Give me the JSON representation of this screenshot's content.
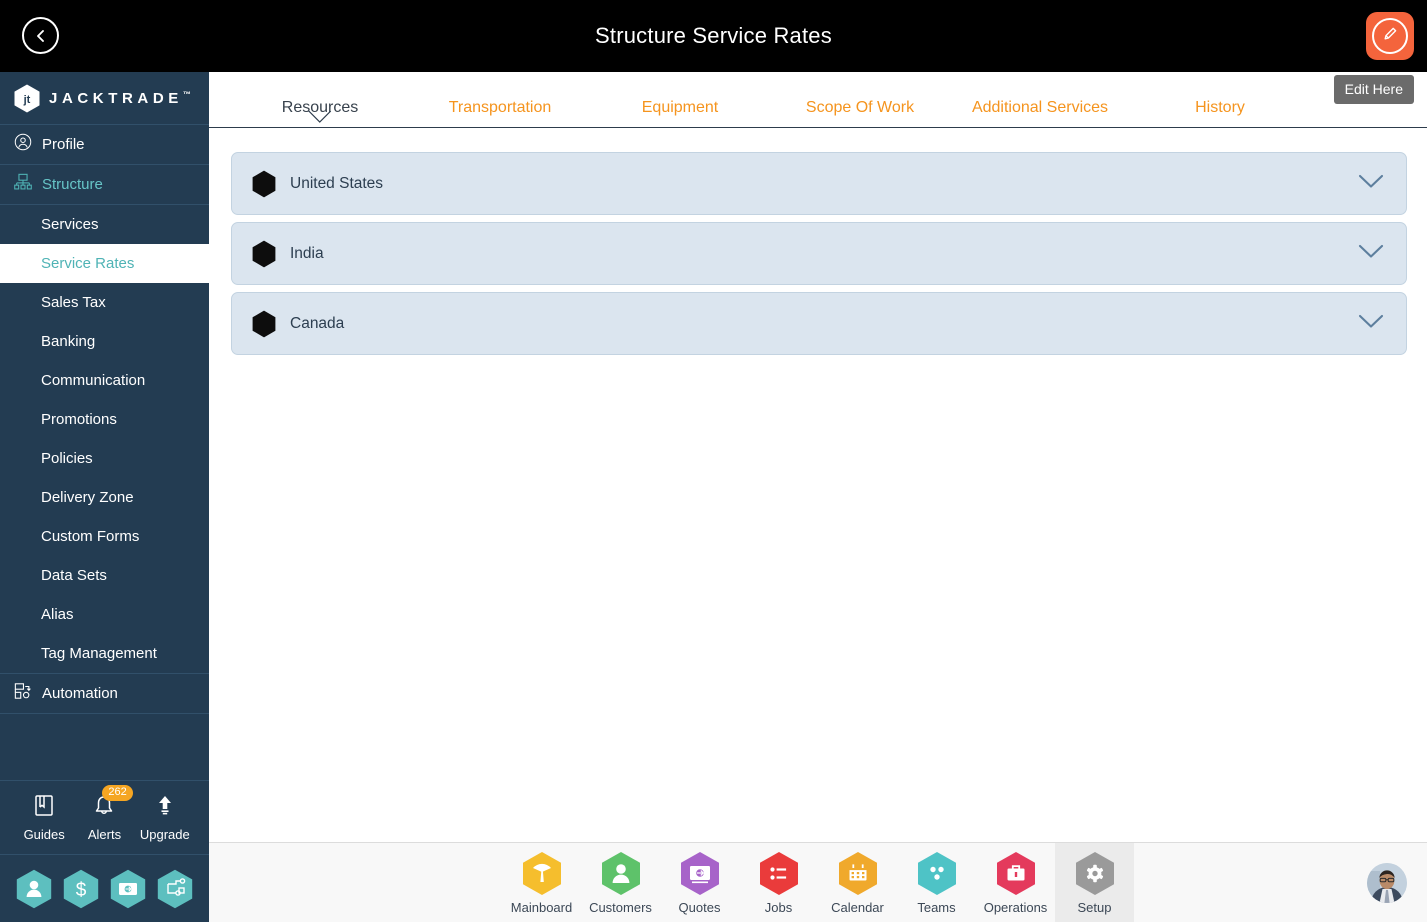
{
  "header": {
    "title": "Structure Service Rates",
    "back_icon": "chevron-left-icon",
    "edit_icon": "pencil-edit-icon"
  },
  "sidebar": {
    "logo_text": "JACKTRADE",
    "logo_tm": "™",
    "logo_icon": "jacktrade-hexagon-logo",
    "nav": [
      {
        "label": "Profile",
        "icon": "user-circle-icon",
        "type": "main",
        "active": false
      },
      {
        "label": "Structure",
        "icon": "sitemap-icon",
        "type": "main",
        "active": true
      },
      {
        "label": "Services",
        "type": "sub",
        "active": false
      },
      {
        "label": "Service Rates",
        "type": "sub",
        "active": true
      },
      {
        "label": "Sales Tax",
        "type": "sub",
        "active": false
      },
      {
        "label": "Banking",
        "type": "sub",
        "active": false
      },
      {
        "label": "Communication",
        "type": "sub",
        "active": false
      },
      {
        "label": "Promotions",
        "type": "sub",
        "active": false
      },
      {
        "label": "Policies",
        "type": "sub",
        "active": false
      },
      {
        "label": "Delivery Zone",
        "type": "sub",
        "active": false
      },
      {
        "label": "Custom Forms",
        "type": "sub",
        "active": false
      },
      {
        "label": "Data Sets",
        "type": "sub",
        "active": false
      },
      {
        "label": "Alias",
        "type": "sub",
        "active": false
      },
      {
        "label": "Tag Management",
        "type": "sub",
        "active": false
      },
      {
        "label": "Automation",
        "icon": "automation-flow-icon",
        "type": "main",
        "active": false
      }
    ],
    "tools": [
      {
        "label": "Guides",
        "icon": "book-icon",
        "badge": null
      },
      {
        "label": "Alerts",
        "icon": "bell-icon",
        "badge": "262"
      },
      {
        "label": "Upgrade",
        "icon": "upload-arrow-icon",
        "badge": null
      }
    ],
    "quick_icons": [
      {
        "icon": "person-hex-icon"
      },
      {
        "icon": "dollar-hex-icon"
      },
      {
        "icon": "cash-hex-icon"
      },
      {
        "icon": "workflow-hex-icon"
      }
    ]
  },
  "tabs": [
    {
      "label": "Resources",
      "active": true
    },
    {
      "label": "Transportation",
      "active": false
    },
    {
      "label": "Equipment",
      "active": false
    },
    {
      "label": "Scope Of Work",
      "active": false
    },
    {
      "label": "Additional Services",
      "active": false
    },
    {
      "label": "History",
      "active": false
    }
  ],
  "tooltip": {
    "label": "Edit Here"
  },
  "accordion": {
    "rows": [
      {
        "label": "United States",
        "icon": "hexagon-marker-icon",
        "expand_icon": "chevron-down-icon"
      },
      {
        "label": "India",
        "icon": "hexagon-marker-icon",
        "expand_icon": "chevron-down-icon"
      },
      {
        "label": "Canada",
        "icon": "hexagon-marker-icon",
        "expand_icon": "chevron-down-icon"
      }
    ]
  },
  "bottom_nav": {
    "items": [
      {
        "label": "Mainboard",
        "icon": "mainboard-icon",
        "color": "#f5be2d",
        "active": false
      },
      {
        "label": "Customers",
        "icon": "customers-icon",
        "color": "#5ec26a",
        "active": false
      },
      {
        "label": "Quotes",
        "icon": "quotes-icon",
        "color": "#a763c9",
        "active": false
      },
      {
        "label": "Jobs",
        "icon": "jobs-icon",
        "color": "#ea3b3b",
        "active": false
      },
      {
        "label": "Calendar",
        "icon": "calendar-icon",
        "color": "#f0a92c",
        "active": false
      },
      {
        "label": "Teams",
        "icon": "teams-icon",
        "color": "#4ec3c6",
        "active": false
      },
      {
        "label": "Operations",
        "icon": "operations-icon",
        "color": "#e43a5c",
        "active": false
      },
      {
        "label": "Setup",
        "icon": "gear-icon",
        "color": "#9a9a9a",
        "active": true
      }
    ],
    "avatar": "user-avatar-photo"
  },
  "colors": {
    "topbar": "#000000",
    "sidebar": "#233c52",
    "accent_orange": "#f5941e",
    "accent_teal": "#4fb3b5",
    "edit_highlight": "#f4643c",
    "accordion_row": "#dbe5ef",
    "badge": "#f5a623"
  }
}
